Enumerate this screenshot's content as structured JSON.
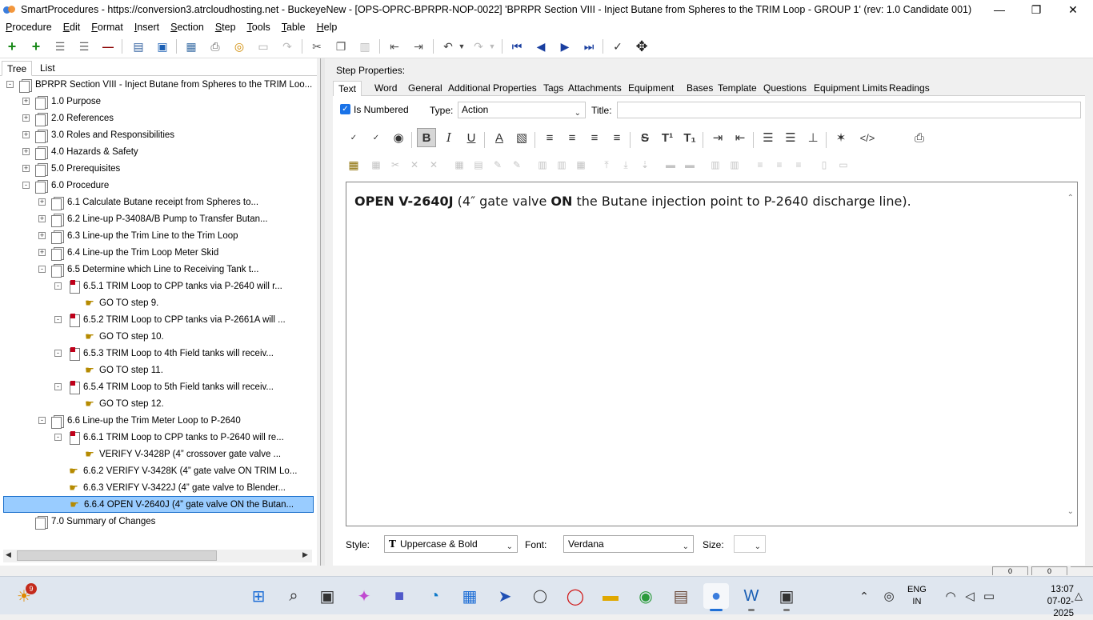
{
  "window": {
    "title": "SmartProcedures - https://conversion3.atrcloudhosting.net - BuckeyeNew - [OPS-OPRC-BPRPR-NOP-0022] 'BPRPR Section VIII - Inject Butane from Spheres to the TRIM Loop - GROUP 1' (rev: 1.0 Candidate 001)"
  },
  "menu": [
    "Procedure",
    "Edit",
    "Format",
    "Insert",
    "Section",
    "Step",
    "Tools",
    "Table",
    "Help"
  ],
  "left_tabs": [
    "Tree",
    "List"
  ],
  "tree": [
    {
      "label": "BPRPR Section VIII - Inject Butane from Spheres to the TRIM Loo...",
      "level": 0,
      "icon": "page",
      "expand": "-"
    },
    {
      "label": "1.0 Purpose",
      "level": 1,
      "icon": "page",
      "expand": "+"
    },
    {
      "label": "2.0 References",
      "level": 1,
      "icon": "page",
      "expand": "+"
    },
    {
      "label": "3.0 Roles and Responsibilities",
      "level": 1,
      "icon": "page",
      "expand": "+"
    },
    {
      "label": "4.0 Hazards & Safety",
      "level": 1,
      "icon": "page",
      "expand": "+"
    },
    {
      "label": "5.0 Prerequisites",
      "level": 1,
      "icon": "page",
      "expand": "+"
    },
    {
      "label": "6.0 Procedure",
      "level": 1,
      "icon": "page",
      "expand": "-"
    },
    {
      "label": "6.1 Calculate Butane receipt from Spheres to...",
      "level": 2,
      "icon": "page",
      "expand": "+"
    },
    {
      "label": "6.2 Line-up P-3408A/B Pump to Transfer Butan...",
      "level": 2,
      "icon": "page",
      "expand": "+"
    },
    {
      "label": "6.3 Line-up the Trim Line to the Trim Loop",
      "level": 2,
      "icon": "page",
      "expand": "+"
    },
    {
      "label": "6.4 Line-up the Trim Loop Meter Skid",
      "level": 2,
      "icon": "page",
      "expand": "+"
    },
    {
      "label": "6.5 Determine which Line to Receiving Tank t...",
      "level": 2,
      "icon": "page",
      "expand": "-"
    },
    {
      "label": "6.5.1 TRIM Loop to CPP tanks via P-2640 will r...",
      "level": 3,
      "icon": "step",
      "expand": "-"
    },
    {
      "label": "GO TO step 9.",
      "level": 4,
      "icon": "hand",
      "expand": ""
    },
    {
      "label": "6.5.2 TRIM Loop to CPP tanks via P-2661A will ...",
      "level": 3,
      "icon": "step",
      "expand": "-"
    },
    {
      "label": "GO TO step 10.",
      "level": 4,
      "icon": "hand",
      "expand": ""
    },
    {
      "label": "6.5.3 TRIM Loop to 4th Field tanks will receiv...",
      "level": 3,
      "icon": "step",
      "expand": "-"
    },
    {
      "label": "GO TO step 11.",
      "level": 4,
      "icon": "hand",
      "expand": ""
    },
    {
      "label": "6.5.4 TRIM Loop to 5th Field tanks will receiv...",
      "level": 3,
      "icon": "step",
      "expand": "-"
    },
    {
      "label": "GO TO step 12.",
      "level": 4,
      "icon": "hand",
      "expand": ""
    },
    {
      "label": "6.6 Line-up the Trim Meter Loop to P-2640",
      "level": 2,
      "icon": "page",
      "expand": "-"
    },
    {
      "label": "6.6.1 TRIM Loop to CPP tanks to P-2640 will re...",
      "level": 3,
      "icon": "step",
      "expand": "-"
    },
    {
      "label": "VERIFY V-3428P (4” crossover gate valve ...",
      "level": 4,
      "icon": "hand",
      "expand": ""
    },
    {
      "label": "6.6.2 VERIFY V-3428K (4” gate valve ON TRIM Lo...",
      "level": 3,
      "icon": "hand",
      "expand": ""
    },
    {
      "label": "6.6.3 VERIFY V-3422J (4” gate valve to Blender...",
      "level": 3,
      "icon": "hand",
      "expand": ""
    },
    {
      "label": "6.6.4 OPEN V-2640J (4” gate valve ON the Butan...",
      "level": 3,
      "icon": "hand",
      "expand": "",
      "selected": true
    },
    {
      "label": "7.0 Summary of Changes",
      "level": 1,
      "icon": "page",
      "expand": ""
    }
  ],
  "step_properties": {
    "heading": "Step Properties:",
    "tabs": [
      "Text",
      "Word",
      "General",
      "Additional Properties",
      "Tags",
      "Attachments",
      "Equipment",
      "Bases",
      "Template",
      "Questions",
      "Equipment Limits",
      "Readings"
    ],
    "is_numbered_label": "Is Numbered",
    "type_label": "Type:",
    "type_value": "Action",
    "title_label": "Title:",
    "title_value": "",
    "editor": {
      "p1": "OPEN V-2640J",
      "p2": " (4″ gate valve ",
      "p3": "ON",
      "p4": " the Butane injection point to P-2640 discharge line)."
    },
    "style_label": "Style:",
    "style_value": "Uppercase & Bold",
    "font_label": "Font:",
    "font_value": "Verdana",
    "size_label": "Size:",
    "size_value": ""
  },
  "status": {
    "box1": "0",
    "box2": "0"
  },
  "taskbar": {
    "widget_badge": "9",
    "lang_line1": "ENG",
    "lang_line2": "IN",
    "time": "13:07",
    "date": "07-02-2025"
  }
}
